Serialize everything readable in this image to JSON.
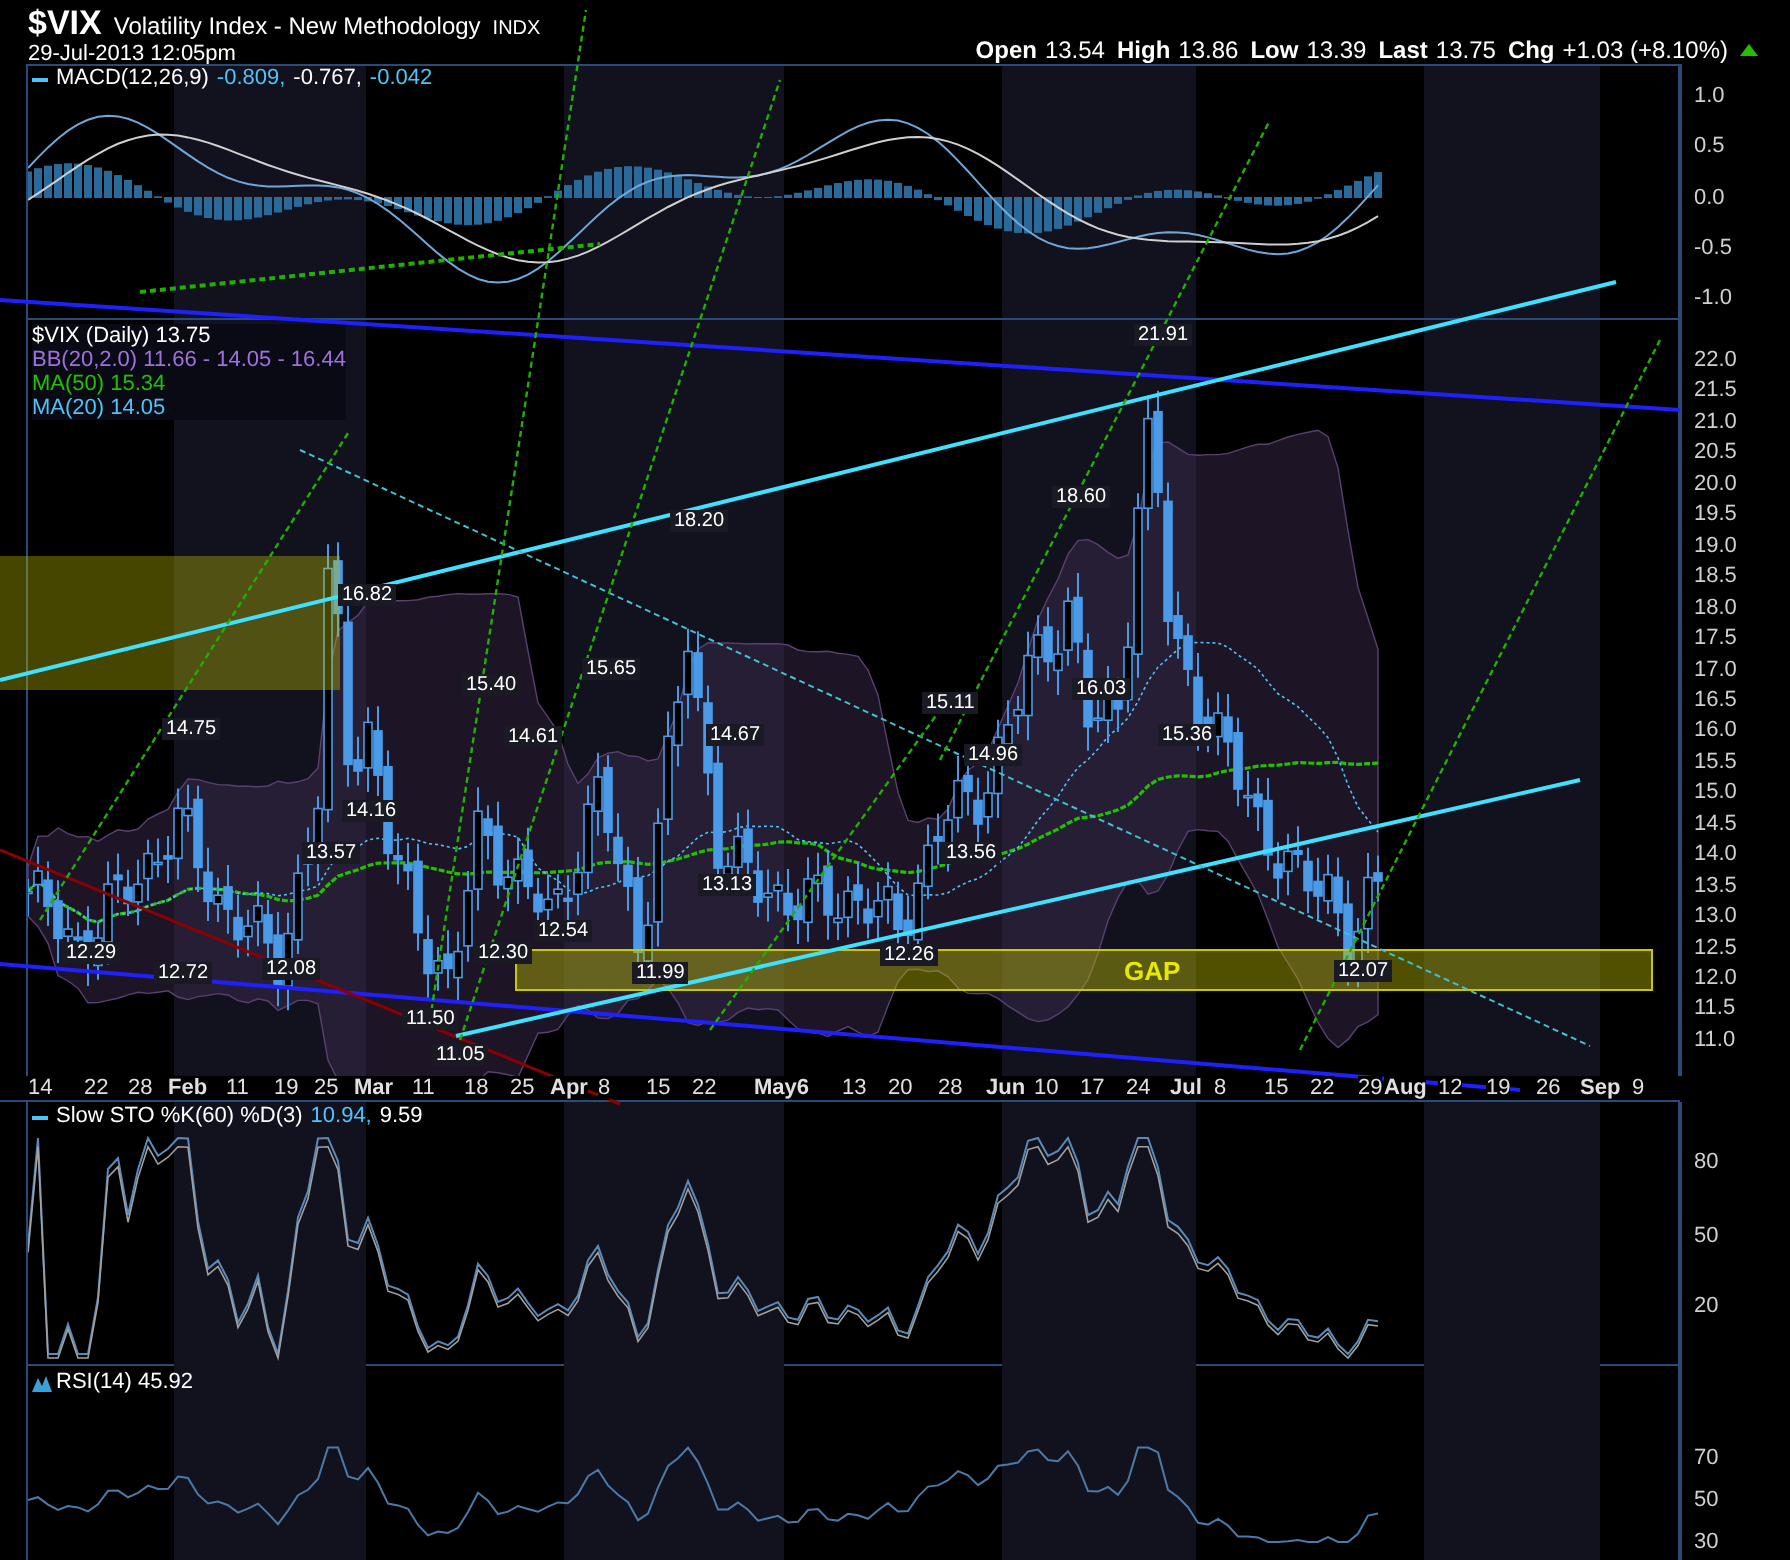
{
  "header": {
    "symbol": "$VIX",
    "name": "Volatility Index - New Methodology",
    "exchange": "INDX",
    "timestamp": "29-Jul-2013 12:05pm",
    "quote": [
      {
        "label": "Open",
        "value": "13.54"
      },
      {
        "label": "High",
        "value": "13.86"
      },
      {
        "label": "Low",
        "value": "13.39"
      },
      {
        "label": "Last",
        "value": "13.75"
      },
      {
        "label": "Chg",
        "value": "+1.03 (+8.10%)"
      }
    ]
  },
  "macd_panel": {
    "legend": {
      "label": "MACD(12,26,9)",
      "values": [
        {
          "text": "-0.809,",
          "color": "#4fc3f7"
        },
        {
          "text": "-0.767,",
          "color": "#ffffff"
        },
        {
          "text": "-0.042",
          "color": "#4fc3f7"
        }
      ]
    },
    "axis_labels": [
      "1.0",
      "0.5",
      "0.0",
      "-0.5",
      "-1.0"
    ]
  },
  "price_panel": {
    "legends": [
      {
        "text": "$VIX (Daily) 13.75",
        "color": "#ffffff"
      },
      {
        "text": "BB(20,2.0) 11.66 - 14.05 - 16.44",
        "color": "#a070e0"
      },
      {
        "text": "MA(50) 15.34",
        "color": "#22c000"
      },
      {
        "text": "MA(20) 14.05",
        "color": "#4fc3f7"
      }
    ],
    "axis_labels": [
      "22.0",
      "21.5",
      "21.0",
      "20.5",
      "20.0",
      "19.5",
      "19.0",
      "18.5",
      "18.0",
      "17.5",
      "17.0",
      "16.5",
      "16.0",
      "15.5",
      "15.0",
      "14.5",
      "14.0",
      "13.5",
      "13.0",
      "12.5",
      "12.0",
      "11.5",
      "11.0"
    ],
    "price_labels": [
      "12.29",
      "14.75",
      "12.72",
      "16.82",
      "14.16",
      "13.57",
      "12.08",
      "15.40",
      "14.61",
      "12.54",
      "12.30",
      "11.50",
      "11.05",
      "15.65",
      "18.20",
      "11.99",
      "14.67",
      "13.13",
      "15.11",
      "13.56",
      "12.26",
      "14.96",
      "18.60",
      "16.03",
      "21.91",
      "15.36",
      "12.07"
    ],
    "gap_label": "GAP"
  },
  "date_axis": {
    "labels": [
      {
        "text": "14",
        "month": false
      },
      {
        "text": "22",
        "month": false
      },
      {
        "text": "28",
        "month": false
      },
      {
        "text": "Feb",
        "month": true
      },
      {
        "text": "11",
        "month": false
      },
      {
        "text": "19",
        "month": false
      },
      {
        "text": "25",
        "month": false
      },
      {
        "text": "Mar",
        "month": true
      },
      {
        "text": "11",
        "month": false
      },
      {
        "text": "18",
        "month": false
      },
      {
        "text": "25",
        "month": false
      },
      {
        "text": "Apr",
        "month": true
      },
      {
        "text": "8",
        "month": false
      },
      {
        "text": "15",
        "month": false
      },
      {
        "text": "22",
        "month": false
      },
      {
        "text": "May6",
        "month": true
      },
      {
        "text": "13",
        "month": false
      },
      {
        "text": "20",
        "month": false
      },
      {
        "text": "28",
        "month": false
      },
      {
        "text": "Jun",
        "month": true
      },
      {
        "text": "10",
        "month": false
      },
      {
        "text": "17",
        "month": false
      },
      {
        "text": "24",
        "month": false
      },
      {
        "text": "Jul",
        "month": true
      },
      {
        "text": "8",
        "month": false
      },
      {
        "text": "15",
        "month": false
      },
      {
        "text": "22",
        "month": false
      },
      {
        "text": "29",
        "month": false
      },
      {
        "text": "Aug",
        "month": true
      },
      {
        "text": "12",
        "month": false
      },
      {
        "text": "19",
        "month": false
      },
      {
        "text": "26",
        "month": false
      },
      {
        "text": "Sep",
        "month": true
      },
      {
        "text": "9",
        "month": false
      }
    ]
  },
  "sto_panel": {
    "legend": {
      "label": "Slow STO %K(60) %D(3)",
      "values": [
        {
          "text": "10.94,",
          "color": "#4fc3f7"
        },
        {
          "text": "9.59",
          "color": "#ffffff"
        }
      ]
    },
    "axis_labels": [
      "80",
      "50",
      "20"
    ]
  },
  "rsi_panel": {
    "legend": {
      "label": "RSI(14) 45.92"
    },
    "axis_labels": [
      "70",
      "50",
      "30"
    ]
  }
}
